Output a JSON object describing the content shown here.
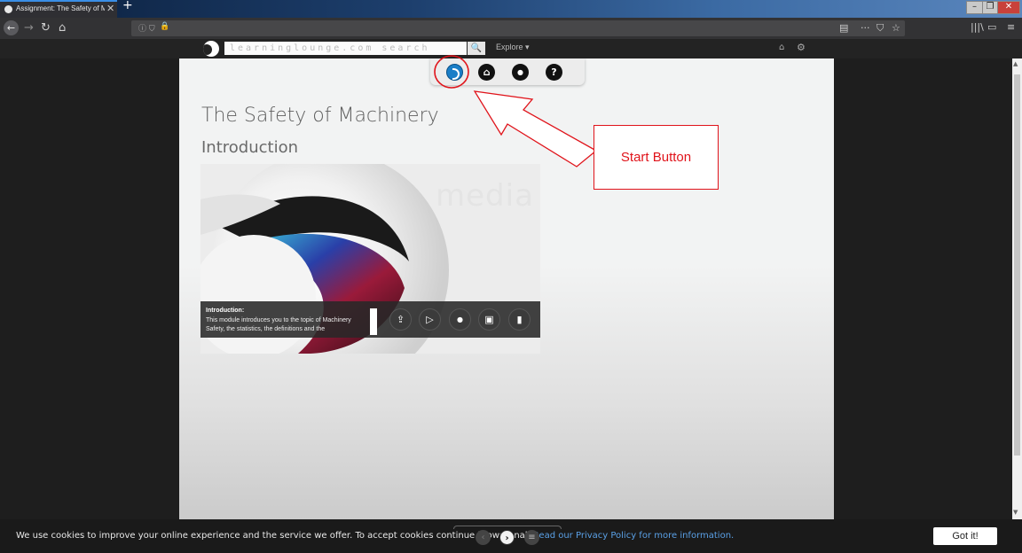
{
  "browser": {
    "tab_title": "Assignment: The Safety of Mac",
    "tab_close": "✕",
    "new_tab": "+",
    "window_controls": [
      "–",
      "❐",
      "✕"
    ]
  },
  "site": {
    "search_placeholder": "learninglounge.com search",
    "search_button": "🔍",
    "explore_label": "Explore ▾"
  },
  "icon_bar": {
    "start_icon": "start-icon",
    "home_icon": "⌂",
    "chat_icon": "●",
    "help_icon": "?"
  },
  "page": {
    "title": "The Safety of Machinery",
    "section": "Introduction"
  },
  "media": {
    "watermark": "media",
    "caption_title": "Introduction:",
    "caption_text": "This module introduces you to the topic of Machinery Safety, the statistics, the definitions and the",
    "controls": {
      "share": "⇪",
      "play": "▷",
      "chat": "●",
      "stop": "▣",
      "stats": "▮"
    }
  },
  "annotation": {
    "label": "Start Button",
    "color": "#e0131a"
  },
  "cookie": {
    "text_before": "We use cookies to improve your online experience and the service we offer. To accept cookies continue browsi",
    "text_mid": "s ",
    "text_after": "nal. ",
    "link_text": "Read our Privacy Policy for more information.",
    "button": "Got it!"
  },
  "pager": {
    "prev": "‹",
    "next": "›",
    "menu": "≡"
  }
}
